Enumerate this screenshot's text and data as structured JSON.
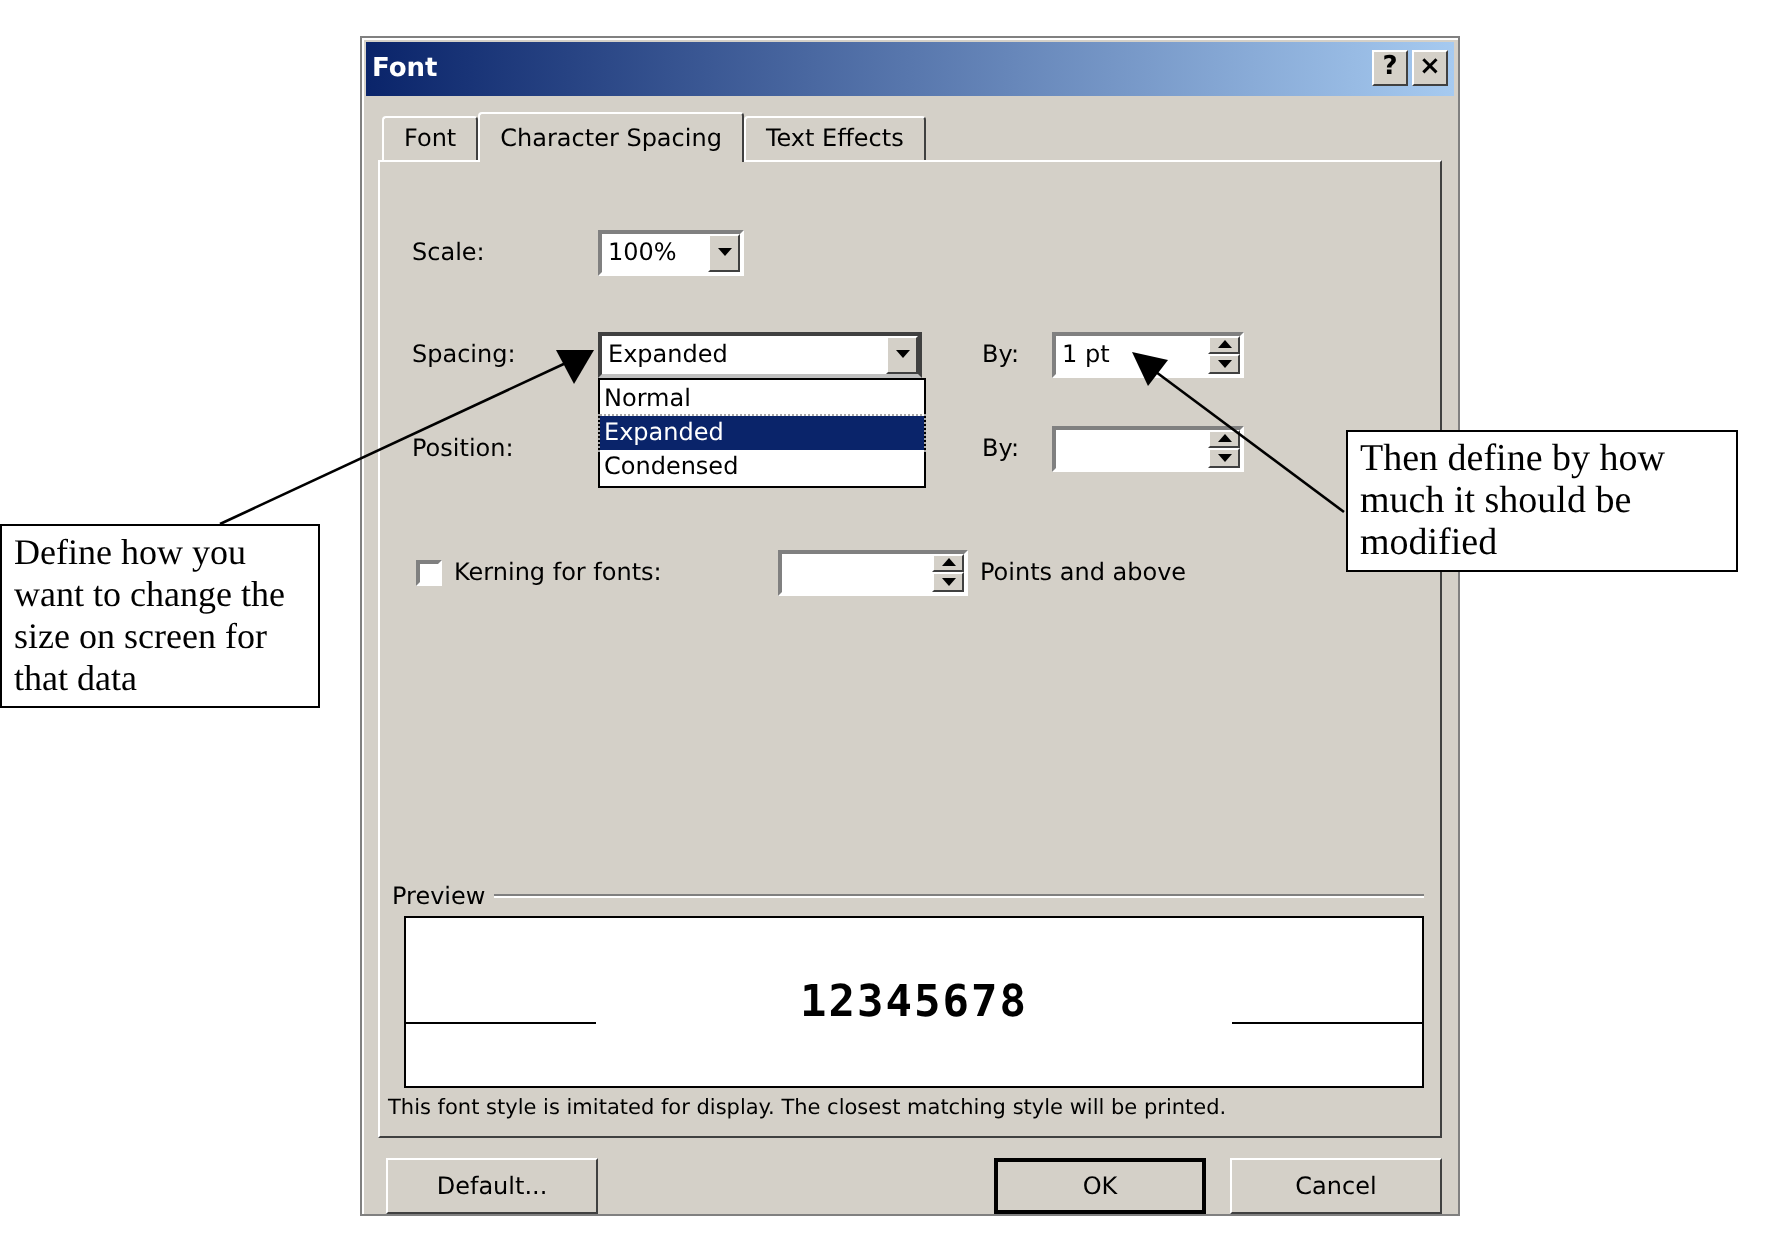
{
  "window": {
    "title": "Font",
    "help": "?",
    "close": "×"
  },
  "tabs": [
    {
      "label": "Font",
      "selected": false
    },
    {
      "label": "Character Spacing",
      "selected": true
    },
    {
      "label": "Text Effects",
      "selected": false
    }
  ],
  "scale": {
    "label": "Scale:",
    "value": "100%"
  },
  "spacing": {
    "label": "Spacing:",
    "value": "Expanded",
    "expanded": true,
    "by_label": "By:",
    "by_value": "1 pt",
    "options": [
      {
        "label": "Normal",
        "selected": false
      },
      {
        "label": "Expanded",
        "selected": true
      },
      {
        "label": "Condensed",
        "selected": false
      }
    ]
  },
  "position": {
    "label": "Position:",
    "by_label": "By:"
  },
  "kerning": {
    "label": "Kerning for fonts:",
    "checked": false,
    "suffix": "Points and above"
  },
  "preview": {
    "label": "Preview",
    "sample": "12345678",
    "note": "This font style is imitated for display. The closest matching style will be printed."
  },
  "buttons": [
    {
      "label": "Default...",
      "default": false
    },
    {
      "label": "OK",
      "default": true
    },
    {
      "label": "Cancel",
      "default": false
    }
  ],
  "callouts": [
    {
      "text": "Define how you want to change the size on screen for that data"
    },
    {
      "text": "Then define by how much it should be modified"
    }
  ]
}
